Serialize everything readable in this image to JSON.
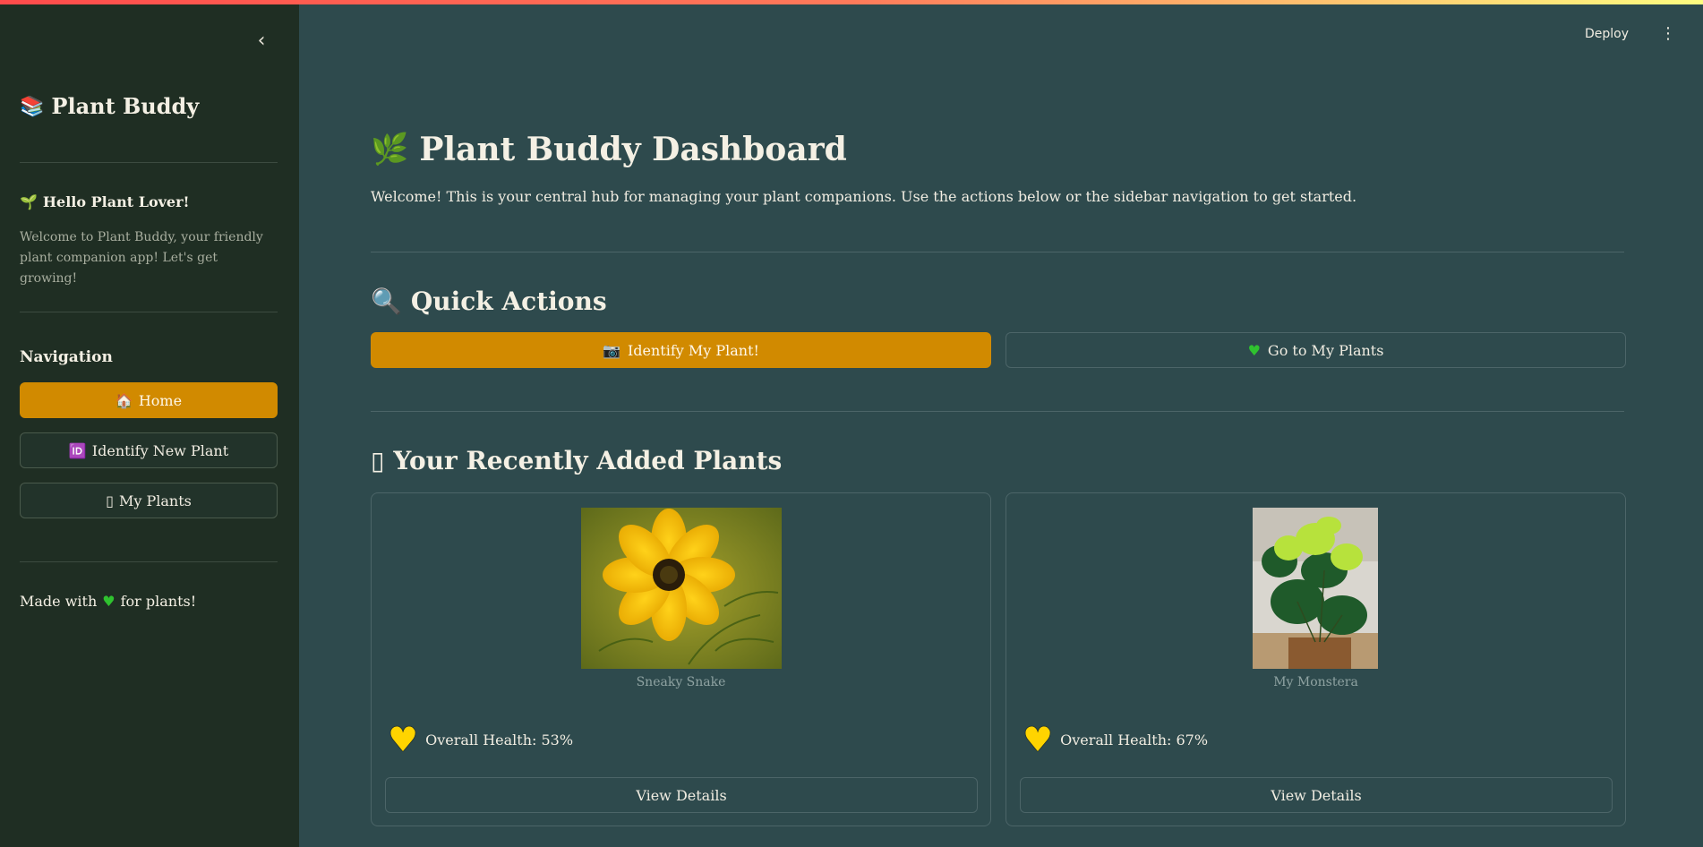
{
  "header": {
    "deploy_label": "Deploy",
    "menu_icon": "⋮",
    "collapse_icon": "‹"
  },
  "sidebar": {
    "title_icon": "📚",
    "title": "Plant Buddy",
    "hello_icon": "🌱",
    "hello": "Hello Plant Lover!",
    "welcome": "Welcome to Plant Buddy, your friendly plant companion app! Let's get growing!",
    "nav_heading": "Navigation",
    "nav": [
      {
        "icon": "🏠",
        "label": "Home",
        "active": true
      },
      {
        "icon": "🆔",
        "label": "Identify New Plant",
        "active": false
      },
      {
        "icon": "▯",
        "label": "My Plants",
        "active": false
      }
    ],
    "footer_prefix": "Made with",
    "footer_heart": "♥",
    "footer_suffix": "for plants!"
  },
  "main": {
    "title_icon": "🌿",
    "title": "Plant Buddy Dashboard",
    "intro": "Welcome! This is your central hub for managing your plant companions. Use the actions below or the sidebar navigation to get started.",
    "quick_actions_icon": "🔍",
    "quick_actions_title": "Quick Actions",
    "identify_icon": "📷",
    "identify_label": "Identify My Plant!",
    "go_icon": "♥",
    "go_label": "Go to My Plants",
    "recent_icon": "▯",
    "recent_title": "Your Recently Added Plants",
    "plants": [
      {
        "name": "Sneaky Snake",
        "health_label": "Overall Health: 53%",
        "health": 53,
        "view_label": "View Details"
      },
      {
        "name": "My Monstera",
        "health_label": "Overall Health: 67%",
        "health": 67,
        "view_label": "View Details"
      }
    ]
  },
  "colors": {
    "accent": "#d18a00",
    "sidebar_bg": "#1f2e23",
    "main_bg": "#2e4a4d",
    "heart_yellow": "#ffd400",
    "heart_green": "#2fc22f"
  }
}
